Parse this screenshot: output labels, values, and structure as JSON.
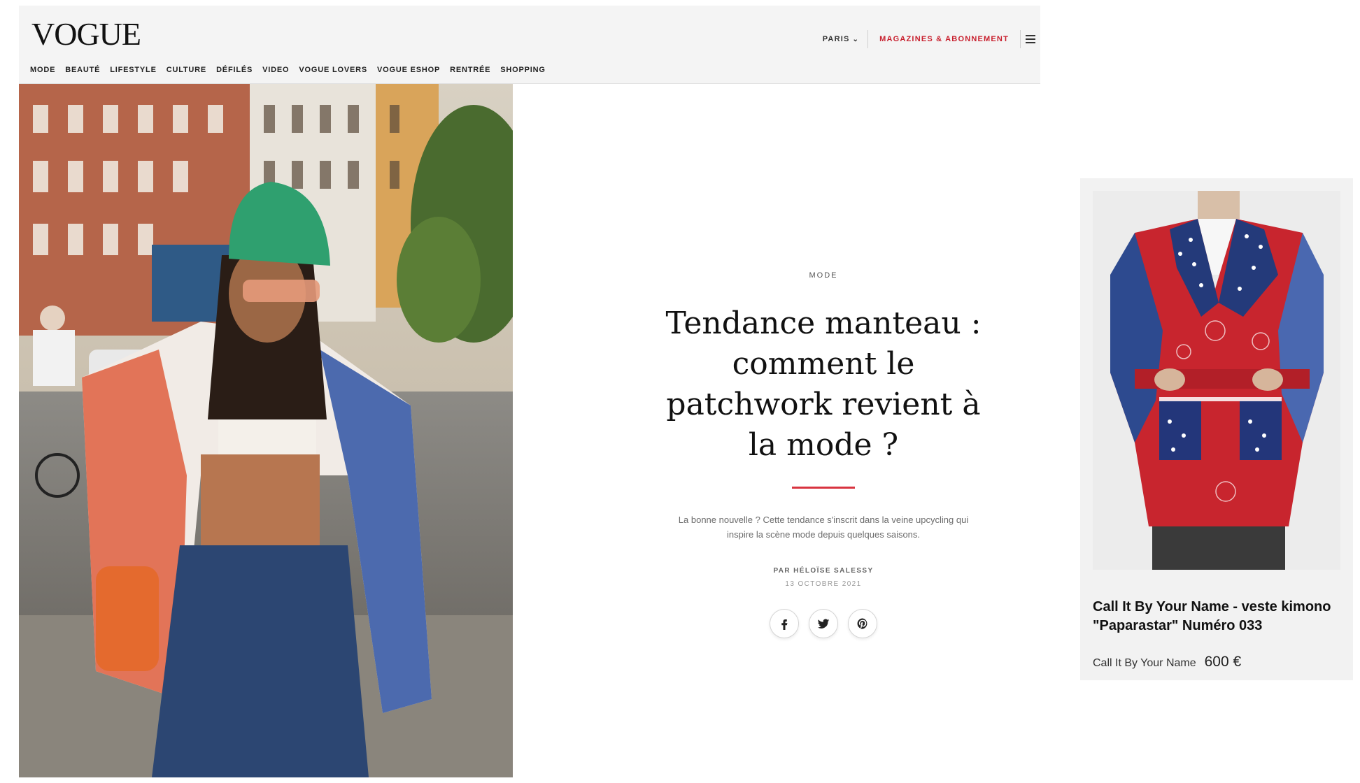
{
  "header": {
    "logo": "VOGUE",
    "edition": "PARIS",
    "subscribe": "MAGAZINES & ABONNEMENT",
    "nav": [
      "MODE",
      "BEAUTÉ",
      "LIFESTYLE",
      "CULTURE",
      "DÉFILÉS",
      "VIDEO",
      "VOGUE LOVERS",
      "VOGUE ESHOP",
      "RENTRÉE",
      "SHOPPING"
    ]
  },
  "article": {
    "category": "MODE",
    "headline": "Tendance manteau : comment le patchwork revient à la mode ?",
    "dek": "La bonne nouvelle ? Cette tendance s'inscrit dans la veine upcycling qui inspire la scène mode depuis quelques saisons.",
    "byline": "PAR HÉLOÏSE SALESSY",
    "date": "13 OCTOBRE 2021",
    "share": [
      {
        "network": "facebook",
        "icon": "facebook-icon"
      },
      {
        "network": "twitter",
        "icon": "twitter-icon"
      },
      {
        "network": "pinterest",
        "icon": "pinterest-icon"
      }
    ]
  },
  "product": {
    "name": "Call It By Your Name - veste kimono \"Paparastar\" Numéro 033",
    "brand": "Call It By Your Name",
    "price": "600 €"
  },
  "colors": {
    "accent_red": "#c8202e",
    "rule_red": "#d8343f",
    "header_bg": "#f4f4f4",
    "card_bg": "#f2f2f2"
  }
}
